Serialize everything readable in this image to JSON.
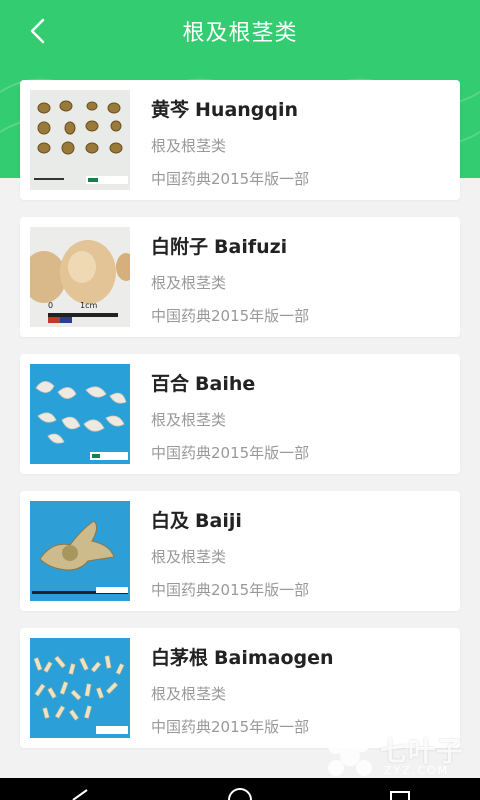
{
  "header": {
    "title": "根及根茎类",
    "back_icon": "chevron-left-icon",
    "accent_color": "#33cc70"
  },
  "items": [
    {
      "name_cn": "黄芩",
      "name_py": "Huangqin",
      "category": "根及根茎类",
      "source": "中国药典2015年版一部",
      "thumb_bg": "#e9ebe8"
    },
    {
      "name_cn": "白附子",
      "name_py": "Baifuzi",
      "category": "根及根茎类",
      "source": "中国药典2015年版一部",
      "thumb_bg": "#ececea"
    },
    {
      "name_cn": "百合",
      "name_py": "Baihe",
      "category": "根及根茎类",
      "source": "中国药典2015年版一部",
      "thumb_bg": "#2aa0d8"
    },
    {
      "name_cn": "白及",
      "name_py": "Baiji",
      "category": "根及根茎类",
      "source": "中国药典2015年版一部",
      "thumb_bg": "#2e9fd6"
    },
    {
      "name_cn": "白茅根",
      "name_py": "Baimaogen",
      "category": "根及根茎类",
      "source": "中国药典2015年版一部",
      "thumb_bg": "#2ba0d8"
    }
  ],
  "thumb_text": {
    "scale_zero": "0",
    "scale_unit": "1cm"
  },
  "watermark": {
    "text": "七叶子",
    "url": "ZYZ.COM"
  },
  "navbar": {
    "back_icon": "nav-back-icon",
    "home_icon": "nav-home-icon",
    "recents_icon": "nav-recents-icon"
  }
}
